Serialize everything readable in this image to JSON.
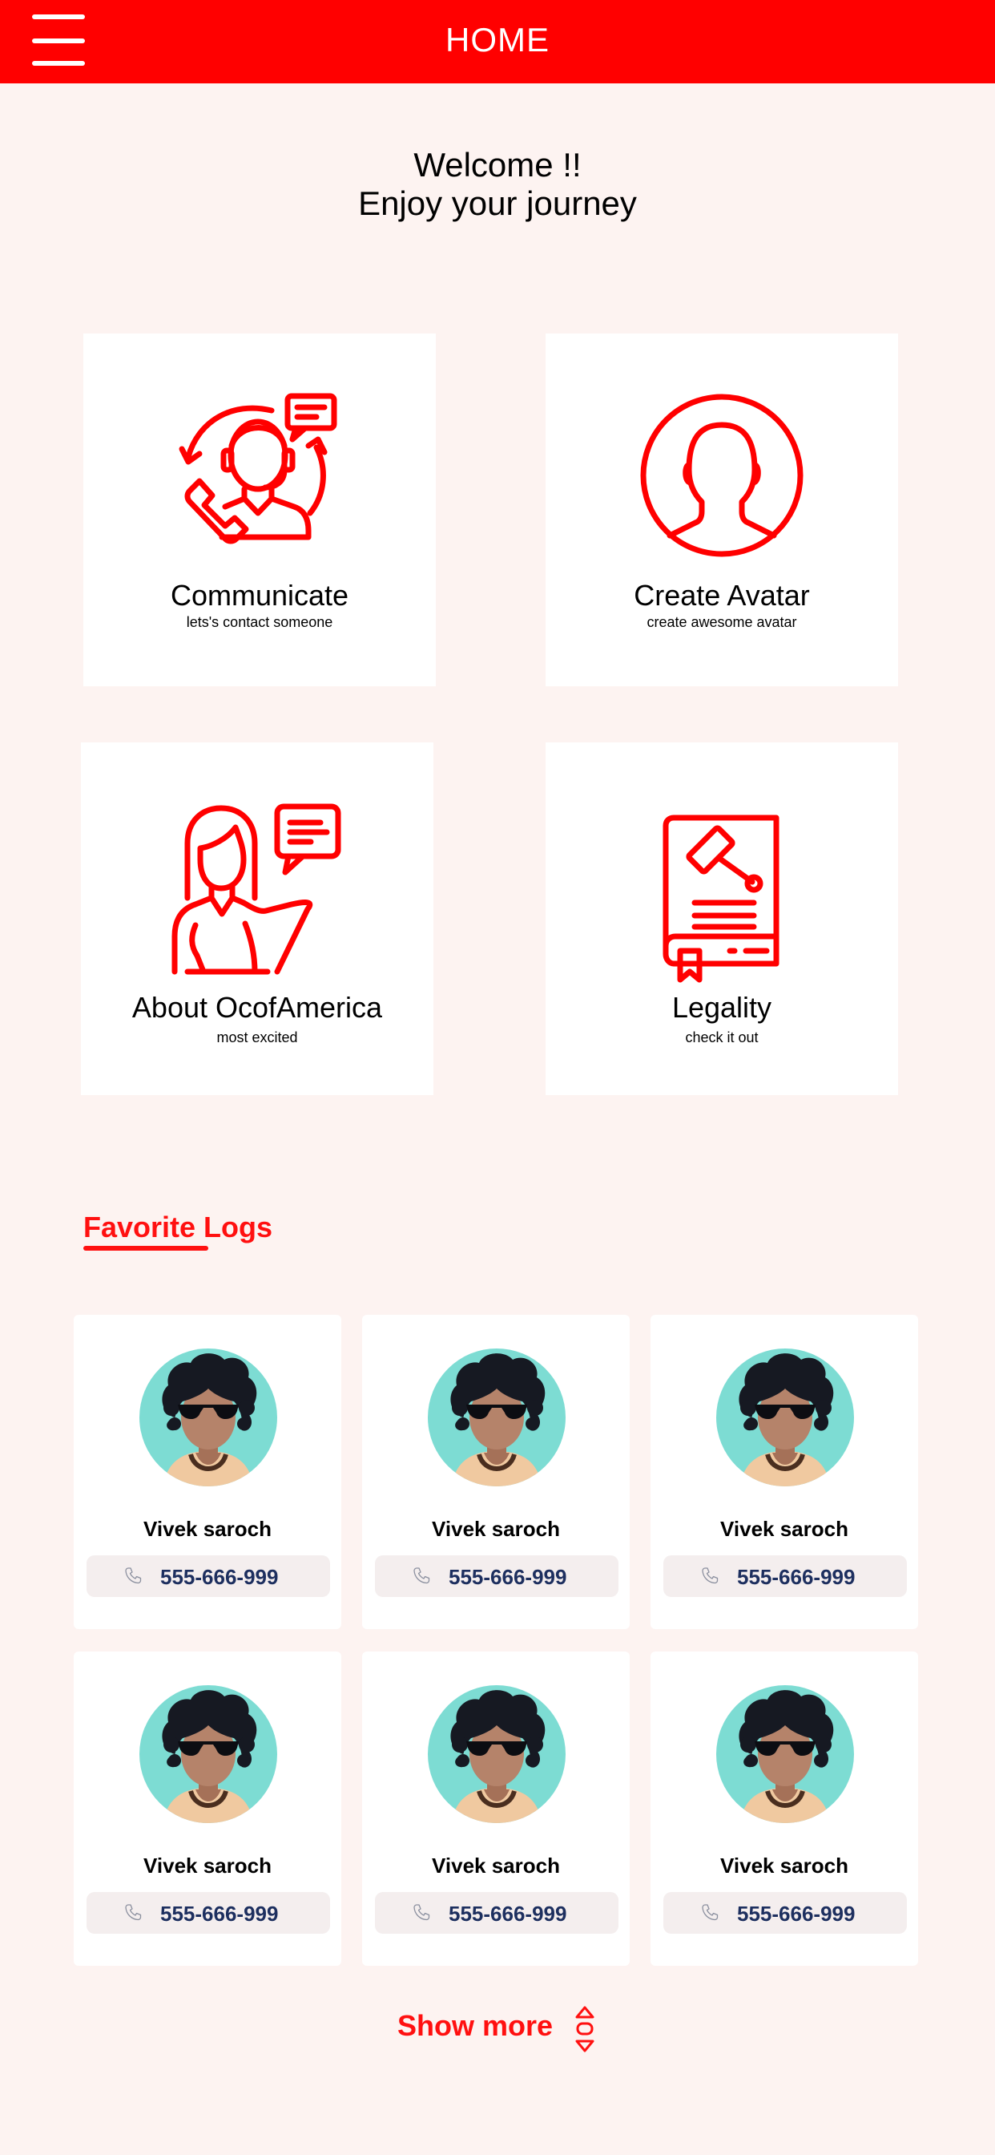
{
  "header": {
    "title": "HOME",
    "menu_icon": "hamburger-menu-icon"
  },
  "welcome": {
    "line1": "Welcome !!",
    "line2": "Enjoy your journey"
  },
  "cards": [
    {
      "title": "Communicate",
      "subtitle": "lets's contact someone",
      "icon": "customer-support-icon"
    },
    {
      "title": "Create Avatar",
      "subtitle": "create awesome avatar",
      "icon": "user-avatar-icon"
    },
    {
      "title": "About OcofAmerica",
      "subtitle": "most excited",
      "icon": "woman-speaking-icon"
    },
    {
      "title": "Legality",
      "subtitle": "check it out",
      "icon": "law-book-icon"
    }
  ],
  "favorites": {
    "title": "Favorite Logs",
    "items": [
      {
        "name": "Vivek saroch",
        "phone": "555-666-999"
      },
      {
        "name": "Vivek saroch",
        "phone": "555-666-999"
      },
      {
        "name": "Vivek saroch",
        "phone": "555-666-999"
      },
      {
        "name": "Vivek saroch",
        "phone": "555-666-999"
      },
      {
        "name": "Vivek saroch",
        "phone": "555-666-999"
      },
      {
        "name": "Vivek saroch",
        "phone": "555-666-999"
      }
    ],
    "show_more": "Show more"
  },
  "colors": {
    "accent": "#ff0000",
    "background": "#fdf3f1",
    "phone_text": "#1d2f5f",
    "avatar_bg": "#7ddcd3"
  }
}
